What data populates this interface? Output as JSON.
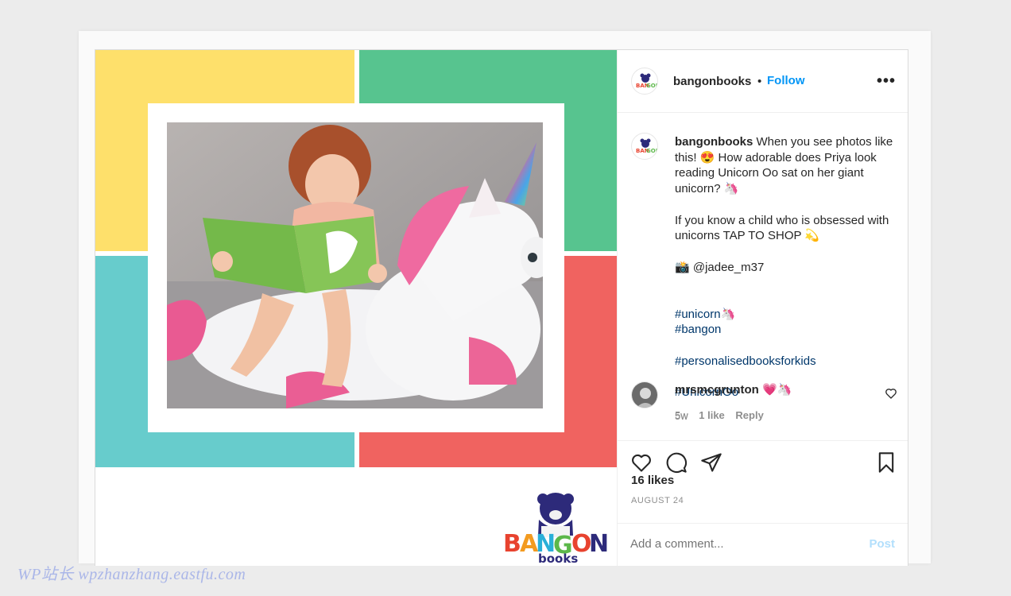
{
  "post": {
    "username": "bangonbooks",
    "follow_label": "Follow",
    "separator": "•",
    "more_label": "•••"
  },
  "caption": {
    "username": "bangonbooks",
    "line1": "When you see photos like this! 😍 How adorable does Priya look reading Unicorn Oo sat on her giant unicorn? 🦄",
    "line2": "If you know a child who is obsessed with unicorns TAP TO SHOP 💫",
    "credit": "📸 @jadee_m37",
    "hashtag1": "#unicorn🦄",
    "hashtag2": "#bangon",
    "hashtag3": "#personalisedbooksforkids",
    "hashtag4": "#UnicornOo",
    "time": "5w"
  },
  "comment": {
    "username": "mrsmcgrunton",
    "text": "💗🦄",
    "time": "5w",
    "likes": "1 like",
    "reply": "Reply"
  },
  "actions": {
    "likes": "16 likes",
    "date": "AUGUST 24"
  },
  "add_comment": {
    "placeholder": "Add a comment...",
    "post_label": "Post"
  },
  "logo": {
    "brand_top": "BANGON",
    "brand_bottom": "books"
  },
  "watermark": "WP站长 wpzhanzhang.eastfu.com",
  "colors": {
    "yellow": "#fee06b",
    "green": "#57c48f",
    "teal": "#67cccc",
    "red": "#f06360",
    "link_blue": "#0095f6",
    "hashtag": "#00376b"
  }
}
